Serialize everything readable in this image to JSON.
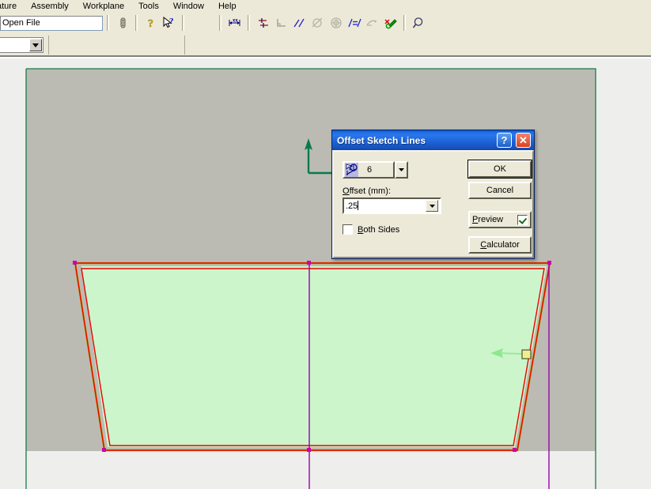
{
  "menubar": {
    "items": [
      {
        "label": "ature"
      },
      {
        "label": "Assembly"
      },
      {
        "label": "Workplane"
      },
      {
        "label": "Tools"
      },
      {
        "label": "Window"
      },
      {
        "label": "Help"
      }
    ]
  },
  "toolbar1": {
    "file_combo_value": "Open File",
    "buttons": [
      {
        "name": "link-icon",
        "title": ""
      },
      {
        "name": "help-question-icon",
        "title": ""
      },
      {
        "name": "context-help-arrow-icon",
        "title": ""
      },
      {
        "name": "dimension-xx-icon",
        "title": ""
      },
      {
        "name": "coincident-constraint-icon",
        "title": ""
      },
      {
        "name": "perpendicular-constraint-icon",
        "title": ""
      },
      {
        "name": "collinear-constraint-icon",
        "title": ""
      },
      {
        "name": "tangent-constraint-icon",
        "title": ""
      },
      {
        "name": "concentric-constraint-icon",
        "title": ""
      },
      {
        "name": "equal-constraint-icon",
        "title": ""
      },
      {
        "name": "parallel-constraint-icon",
        "title": ""
      },
      {
        "name": "fix-constraint-icon",
        "title": ""
      },
      {
        "name": "zoom-magnifier-icon",
        "title": ""
      }
    ]
  },
  "toolbar2": {
    "combo_value": ""
  },
  "dialog": {
    "title": "Offset Sketch Lines",
    "help_button": "?",
    "close_button": "✕",
    "tool_selector": {
      "icon": "offset-sketch-lines-icon",
      "count": "6"
    },
    "offset_label_underlined": "O",
    "offset_label_rest": "ffset (mm):",
    "offset_value": ".25",
    "both_sides": {
      "label_underlined": "B",
      "label_rest": "oth Sides",
      "checked": false
    },
    "buttons": {
      "ok": "OK",
      "cancel": "Cancel",
      "calculator_underlined": "C",
      "calculator_rest": "alculator"
    },
    "preview": {
      "label_underlined": "P",
      "label_rest": "review",
      "checked": true
    }
  },
  "canvas": {
    "workplane_border_color": "#1a7a4a",
    "sketch_fill_color": "#ccf5cc",
    "offset_line_color": "#ee0000",
    "original_line_color": "#9a9a00",
    "centerline_color": "#9900aa",
    "axis_color": "#0a7a4a",
    "endpoint_color": "#cc00aa",
    "drag_handle_color": "#eeee88",
    "drag_arrow_color": "#88ee88",
    "background_color": "#eeeeec",
    "outside_plane_color": "#bbbbb4"
  }
}
